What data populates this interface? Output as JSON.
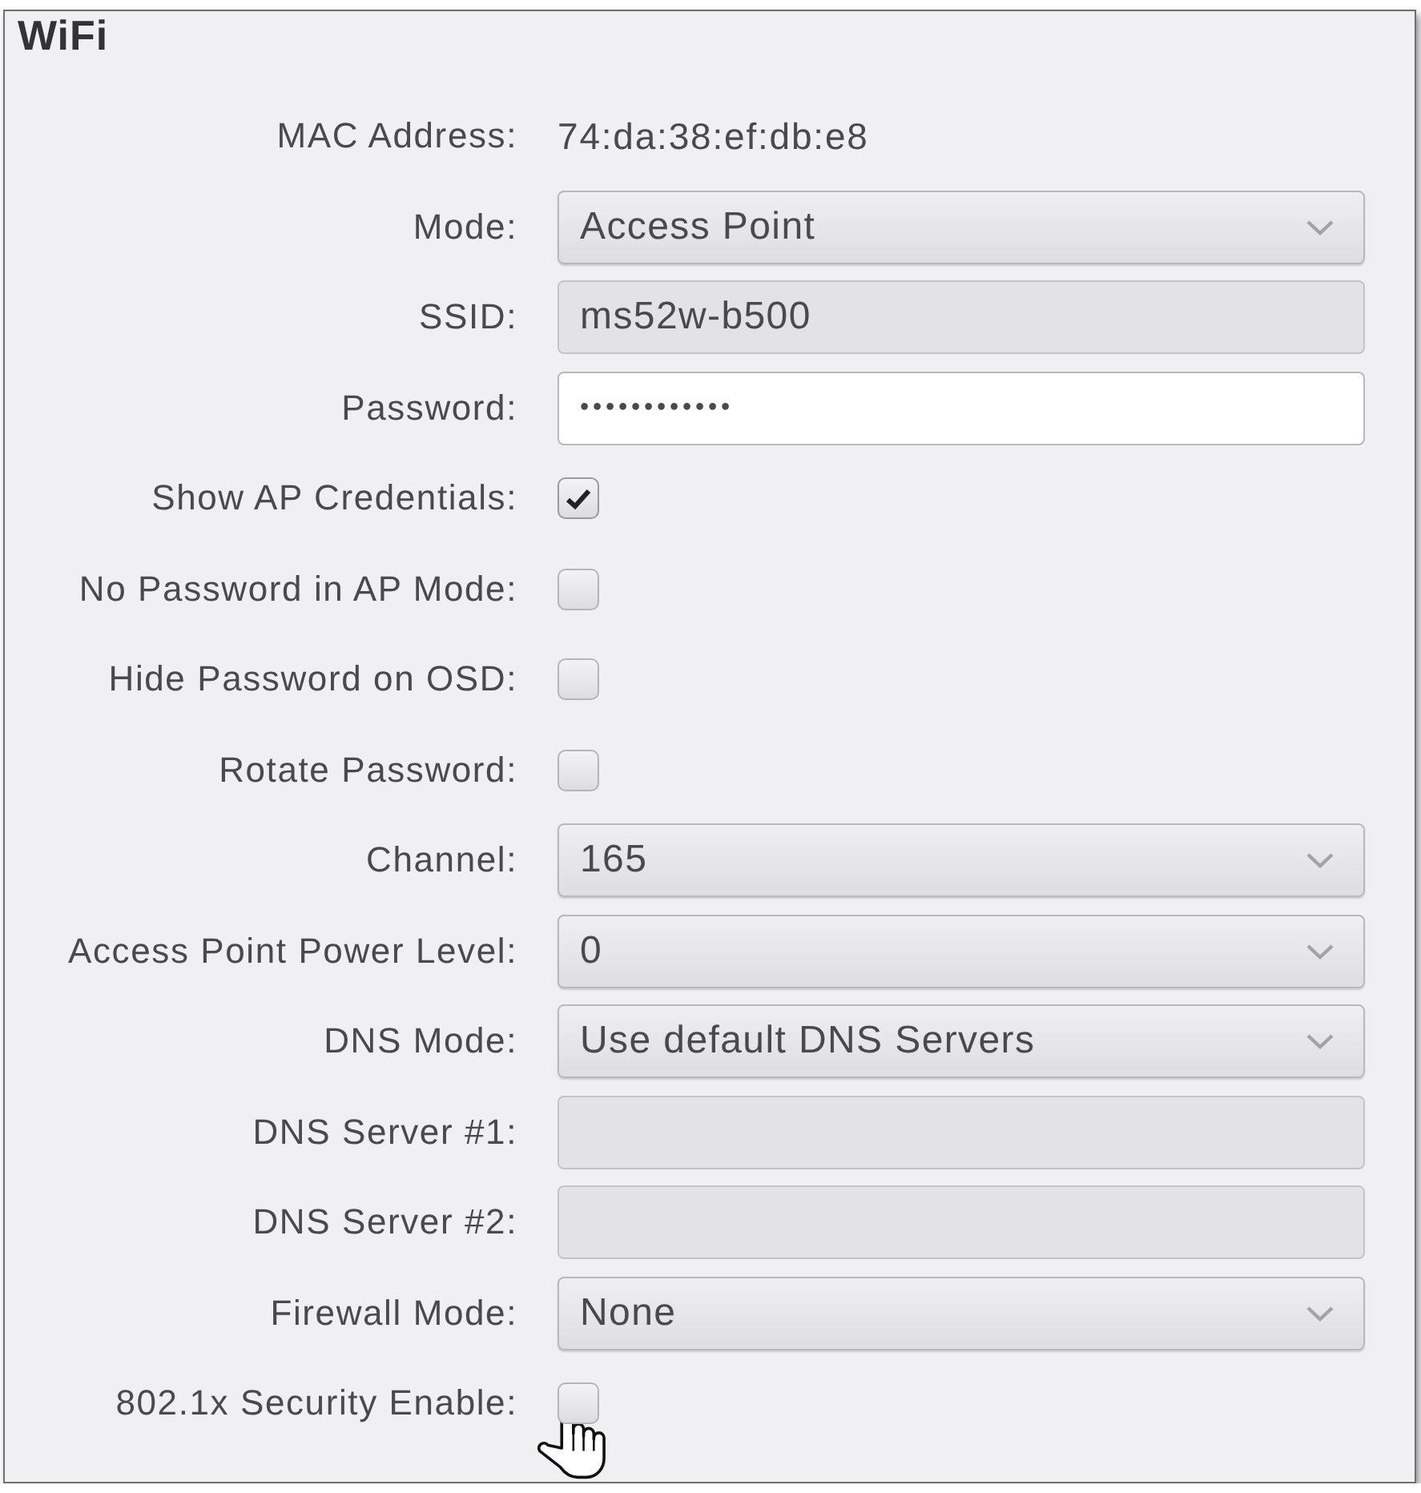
{
  "panel": {
    "title": "WiFi"
  },
  "rows": [
    {
      "kind": "text",
      "label": "MAC Address:",
      "value": "74:da:38:ef:db:e8"
    },
    {
      "kind": "select",
      "label": "Mode:",
      "value": "Access Point"
    },
    {
      "kind": "input",
      "label": "SSID:",
      "value": "ms52w-b500",
      "disabled": true
    },
    {
      "kind": "password",
      "label": "Password:",
      "value": "••••••••••••",
      "disabled": false
    },
    {
      "kind": "checkbox",
      "label": "Show AP Credentials:",
      "checked": true,
      "hovered": false
    },
    {
      "kind": "checkbox",
      "label": "No Password in AP Mode:",
      "checked": false,
      "hovered": false
    },
    {
      "kind": "checkbox",
      "label": "Hide Password on OSD:",
      "checked": false,
      "hovered": false
    },
    {
      "kind": "checkbox",
      "label": "Rotate Password:",
      "checked": false,
      "hovered": false
    },
    {
      "kind": "select",
      "label": "Channel:",
      "value": "165"
    },
    {
      "kind": "select",
      "label": "Access Point Power Level:",
      "value": "0"
    },
    {
      "kind": "select",
      "label": "DNS Mode:",
      "value": "Use default DNS Servers"
    },
    {
      "kind": "input",
      "label": "DNS Server #1:",
      "disabled": true
    },
    {
      "kind": "input",
      "label": "DNS Server #2:",
      "disabled": true
    },
    {
      "kind": "select",
      "label": "Firewall Mode:",
      "value": "None"
    },
    {
      "kind": "checkbox",
      "label": "802.1x Security Enable:",
      "checked": false,
      "hovered": true
    }
  ]
}
